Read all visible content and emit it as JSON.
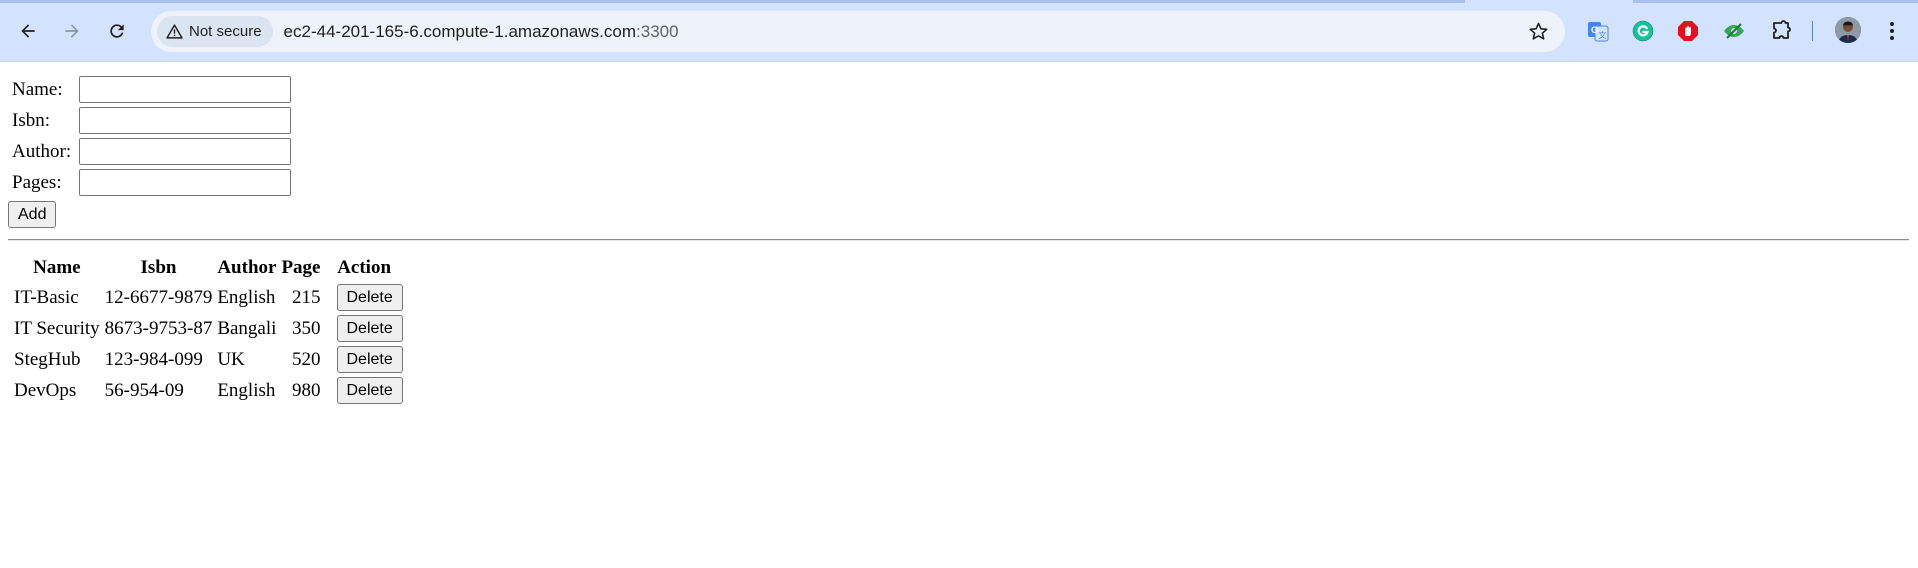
{
  "browser": {
    "security_label": "Not secure",
    "url_host": "ec2-44-201-165-6.compute-1.amazonaws.com",
    "url_port": ":3300",
    "extensions": [
      "google-translate-icon",
      "grammarly-icon",
      "adblock-icon",
      "eye-extension-icon",
      "puzzle-icon"
    ]
  },
  "form": {
    "name_label": "Name:",
    "isbn_label": "Isbn:",
    "author_label": "Author:",
    "pages_label": "Pages:",
    "name_value": "",
    "isbn_value": "",
    "author_value": "",
    "pages_value": "",
    "add_label": "Add"
  },
  "table": {
    "headers": [
      "Name",
      "Isbn",
      "Author",
      "Page",
      "Action"
    ],
    "rows": [
      {
        "name": "IT-Basic",
        "isbn": "12-6677-9879",
        "author": "English",
        "pages": "215",
        "action": "Delete"
      },
      {
        "name": "IT Security",
        "isbn": "8673-9753-87",
        "author": "Bangali",
        "pages": "350",
        "action": "Delete"
      },
      {
        "name": "StegHub",
        "isbn": "123-984-099",
        "author": "UK",
        "pages": "520",
        "action": "Delete"
      },
      {
        "name": "DevOps",
        "isbn": "56-954-09",
        "author": "English",
        "pages": "980",
        "action": "Delete"
      }
    ]
  },
  "colors": {
    "chrome_bg": "#d3e3fd",
    "omnibox_bg": "#eef3fb",
    "button_bg": "#efefef"
  }
}
